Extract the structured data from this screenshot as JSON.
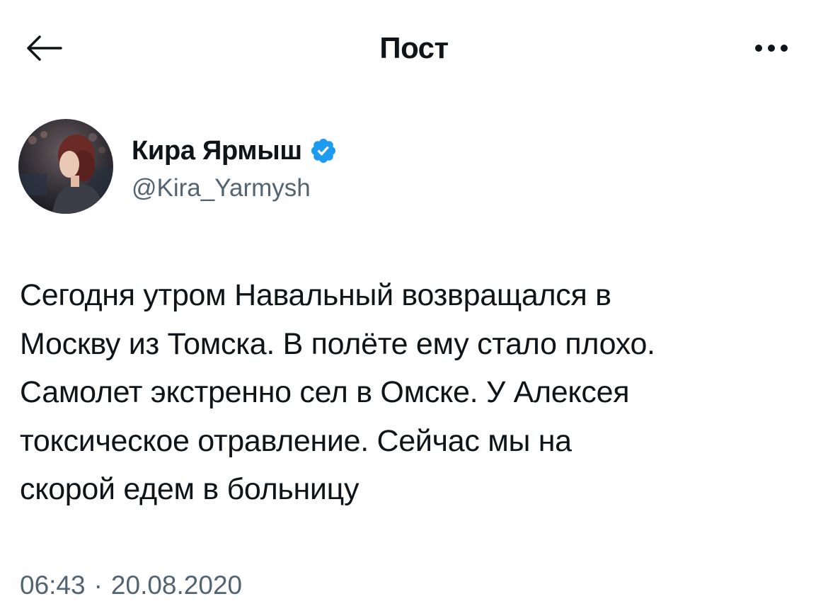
{
  "header": {
    "title": "Пост",
    "back_icon": "arrow-left-icon",
    "more_icon": "more-horizontal-icon"
  },
  "author": {
    "display_name": "Кира Ярмыш",
    "handle": "@Kira_Yarmysh",
    "verified": true,
    "verified_icon": "verified-badge-icon",
    "verified_color": "#1d9bf0"
  },
  "tweet": {
    "text": "Сегодня утром Навальный возвращался в\nМоскву из Томска. В полёте ему стало плохо.\nСамолет экстренно сел в Омске. У Алексея\nтоксическое отравление. Сейчас мы на\nскорой едем в больницу",
    "time": "06:43",
    "separator": "·",
    "date": "20.08.2020"
  },
  "colors": {
    "text_primary": "#0f1419",
    "text_secondary": "#536471",
    "accent": "#1d9bf0"
  }
}
